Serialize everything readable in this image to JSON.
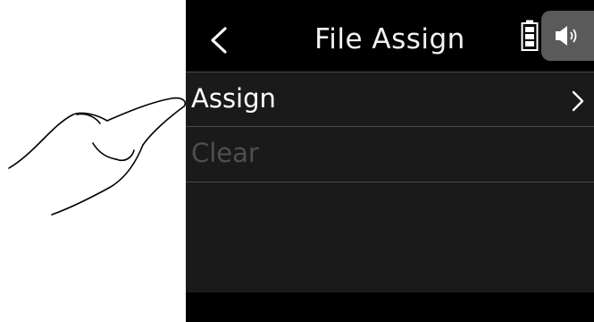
{
  "screen": {
    "title": "File Assign",
    "back_icon": "chevron-left-icon",
    "battery_icon": "battery-icon",
    "speaker_icon": "speaker-icon"
  },
  "menu": {
    "items": [
      {
        "label": "Assign",
        "enabled": true,
        "icon": "chevron-right-icon"
      },
      {
        "label": "Clear",
        "enabled": false
      }
    ]
  },
  "colors": {
    "background": "#000000",
    "menu_background": "#1a1a1a",
    "text": "#ffffff",
    "disabled_text": "#4e4e4e",
    "divider": "#4a4a4a",
    "speaker_button": "#5a5a5a"
  }
}
